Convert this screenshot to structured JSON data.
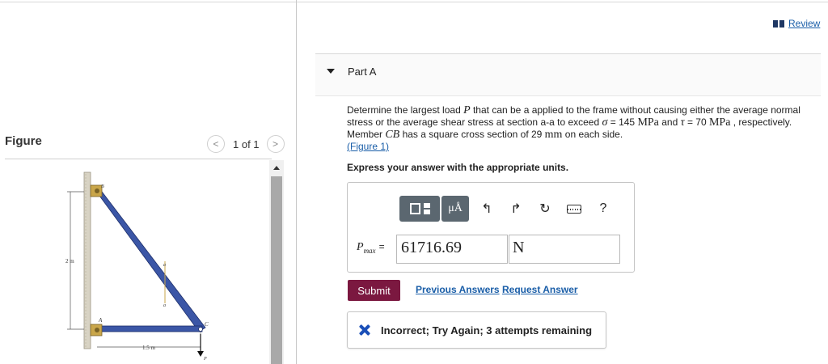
{
  "header": {
    "review_label": "Review"
  },
  "figure_pane": {
    "title": "Figure",
    "pager_text": "1 of 1",
    "prev_glyph": "<",
    "next_glyph": ">",
    "labels": {
      "b": "B",
      "a_top": "a",
      "dim_2m": "2 m",
      "a_bot": "a",
      "pt_a": "A",
      "pt_c": "C",
      "dim_15m": "1.5 m",
      "load_p": "P"
    }
  },
  "part": {
    "title": "Part A",
    "question": {
      "t1": "Determine the largest load ",
      "P": "P",
      "t2": " that can be a applied to the frame without causing either the average normal stress or the average shear stress at section a-a to exceed ",
      "sigma": "σ",
      "t3": " = 145 ",
      "mpa1": "MPa",
      "t4": " and ",
      "tau": "τ",
      "t5": " = 70 ",
      "mpa2": "MPa",
      "t6": " , respectively. Member ",
      "CB": "CB",
      "t7": " has a square cross section of 29 ",
      "mm": "mm",
      "t8": " on each side.",
      "figure_link": "(Figure 1)"
    },
    "units_prompt": "Express your answer with the appropriate units."
  },
  "toolbar": {
    "mu_label": "μÅ",
    "undo": "↰",
    "redo": "↱",
    "reset": "↻",
    "help": "?"
  },
  "answer": {
    "var": "P",
    "sub": "max",
    "eq": "=",
    "value": "61716.69",
    "unit": "N"
  },
  "actions": {
    "submit_label": "Submit",
    "previous_answers": "Previous Answers",
    "request_answer": "Request Answer"
  },
  "feedback": {
    "text": "Incorrect; Try Again; 3 attempts remaining"
  },
  "colors": {
    "accent_submit": "#7b1840",
    "link": "#1a5ea8",
    "incorrect_icon": "#1a4fb8",
    "member": "#3b56a6",
    "pin": "#c9a64a"
  }
}
